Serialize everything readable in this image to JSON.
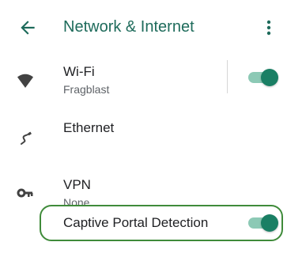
{
  "header": {
    "title": "Network & Internet",
    "back_icon": "arrow-back-icon",
    "overflow_icon": "more-vert-icon"
  },
  "items": [
    {
      "label": "Wi-Fi",
      "sublabel": "Fragblast",
      "icon": "wifi-icon",
      "toggle": true
    },
    {
      "label": "Ethernet",
      "icon": "ethernet-icon"
    },
    {
      "label": "VPN",
      "sublabel": "None",
      "icon": "vpn-key-icon"
    },
    {
      "label": "Captive Portal Detection",
      "toggle": true,
      "highlighted": true
    }
  ],
  "colors": {
    "accent": "#1e6b5b",
    "toggle_thumb": "#1a7f64",
    "toggle_track": "#8cc9b5",
    "highlight_border": "#3f8b3a"
  }
}
